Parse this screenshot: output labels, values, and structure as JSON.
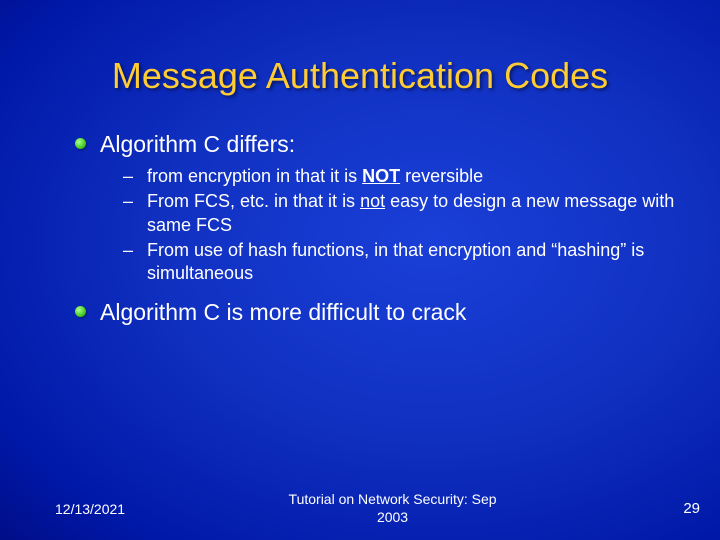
{
  "title": "Message Authentication Codes",
  "bullets": [
    {
      "text": "Algorithm C differs:"
    },
    {
      "text": "Algorithm C is more difficult to crack"
    }
  ],
  "subs": [
    {
      "pre": "from encryption in that it is ",
      "em": "NOT",
      "post": " reversible"
    },
    {
      "pre": "From FCS, etc. in that it is ",
      "em": "not",
      "post": " easy to design a new message with same FCS"
    },
    {
      "pre": "From use of hash functions, in that encryption and “hashing” is simultaneous",
      "em": "",
      "post": ""
    }
  ],
  "footer": {
    "date": "12/13/2021",
    "center1": "Tutorial on Network Security: Sep",
    "center2": "2003",
    "page": "29"
  },
  "dash": "–"
}
